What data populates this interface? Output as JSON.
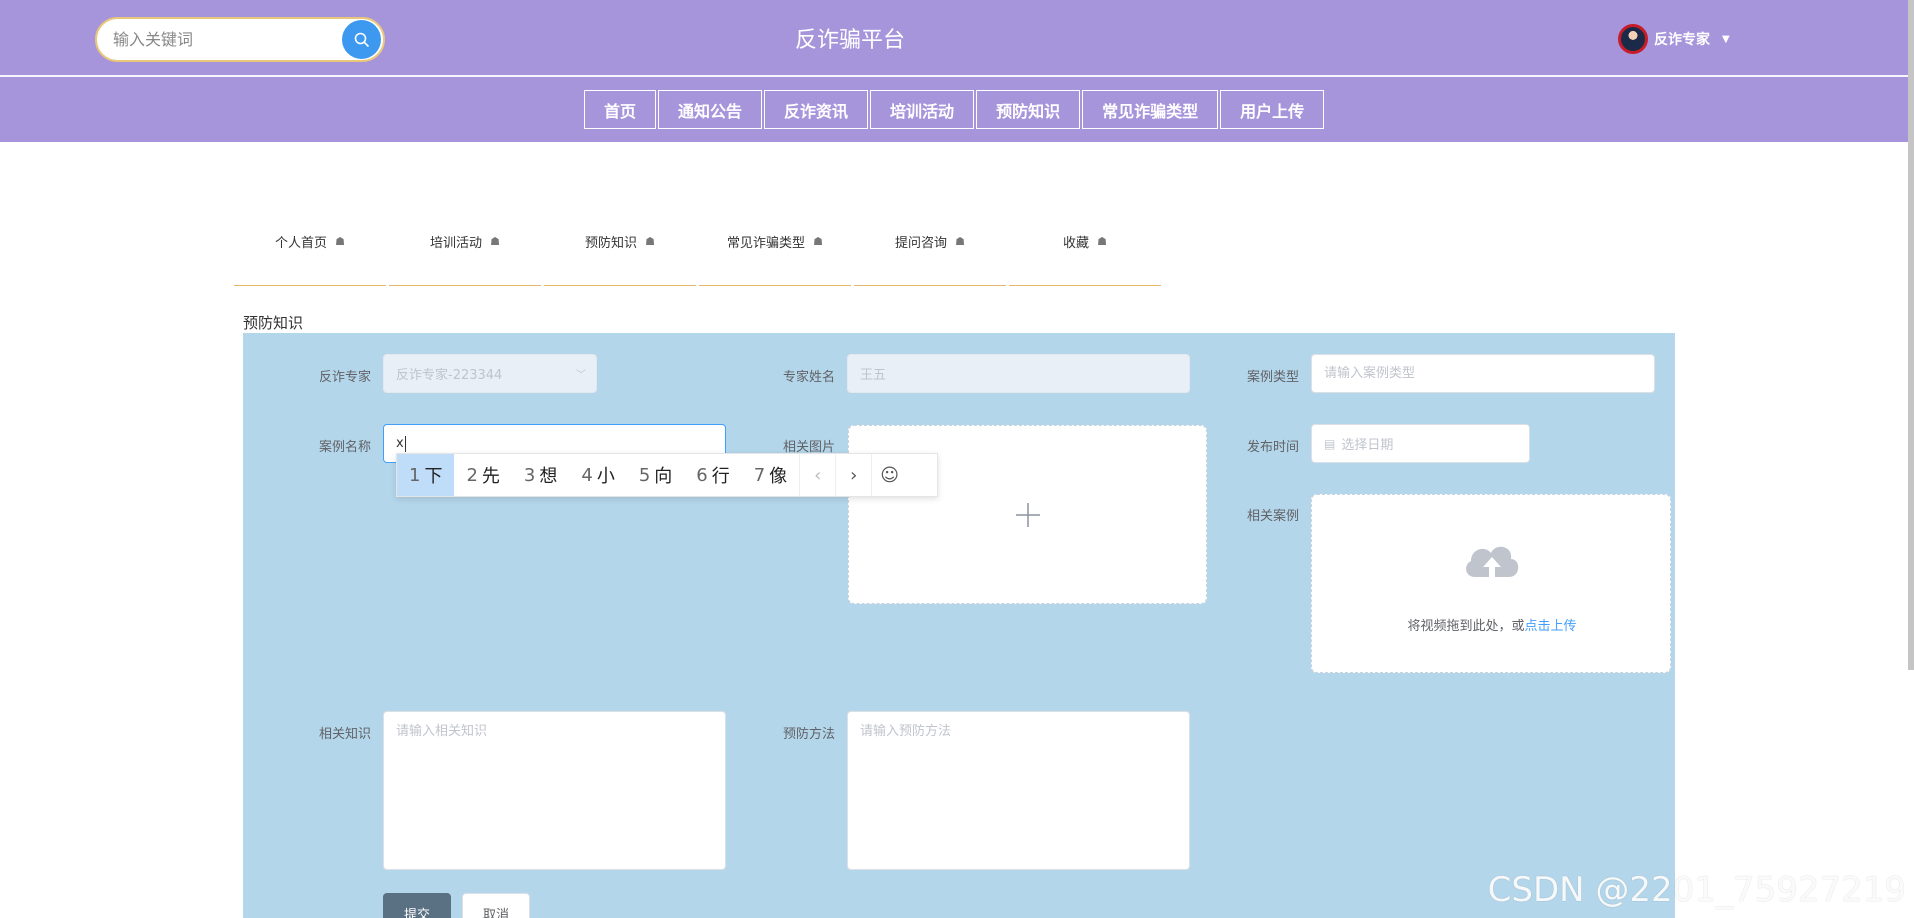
{
  "header": {
    "search_placeholder": "输入关键词",
    "site_title": "反诈骗平台",
    "user_name": "反诈专家"
  },
  "nav": [
    "首页",
    "通知公告",
    "反诈资讯",
    "培训活动",
    "预防知识",
    "常见诈骗类型",
    "用户上传"
  ],
  "subtabs": [
    "个人首页",
    "培训活动",
    "预防知识",
    "常见诈骗类型",
    "提问咨询",
    "收藏"
  ],
  "section_label": "预防知识",
  "form": {
    "expert_label": "反诈专家",
    "expert_value": "反诈专家-223344",
    "expert_name_label": "专家姓名",
    "expert_name_value": "王五",
    "case_type_label": "案例类型",
    "case_type_placeholder": "请输入案例类型",
    "case_name_label": "案例名称",
    "case_name_value": "x",
    "image_label": "相关图片",
    "publish_time_label": "发布时间",
    "publish_time_placeholder": "选择日期",
    "related_case_label": "相关案例",
    "upload_text": "将视频拖到此处，或",
    "upload_link": "点击上传",
    "knowledge_label": "相关知识",
    "knowledge_placeholder": "请输入相关知识",
    "method_label": "预防方法",
    "method_placeholder": "请输入预防方法",
    "submit": "提交",
    "cancel": "取消"
  },
  "ime": {
    "candidates": [
      {
        "n": "1",
        "c": "下"
      },
      {
        "n": "2",
        "c": "先"
      },
      {
        "n": "3",
        "c": "想"
      },
      {
        "n": "4",
        "c": "小"
      },
      {
        "n": "5",
        "c": "向"
      },
      {
        "n": "6",
        "c": "行"
      },
      {
        "n": "7",
        "c": "像"
      }
    ]
  },
  "watermark": "CSDN @2201_75927219",
  "colors": {
    "header": "#a795dc",
    "panel": "#b4d6ea",
    "accent": "#3d98f0"
  }
}
